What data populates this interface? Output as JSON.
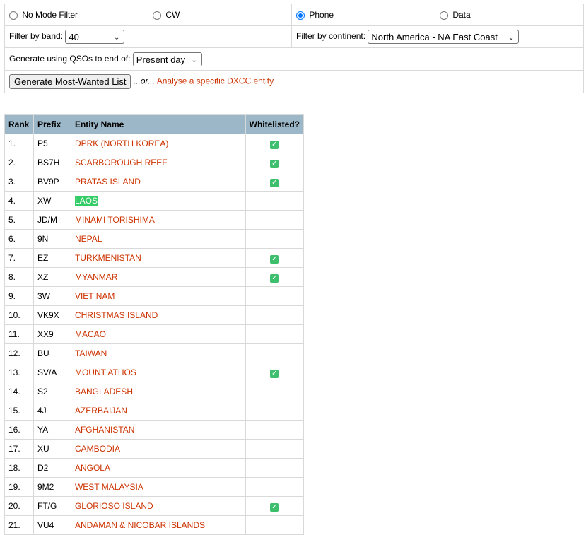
{
  "mode_filter": {
    "options": [
      {
        "label": "No Mode Filter",
        "checked": false
      },
      {
        "label": "CW",
        "checked": false
      },
      {
        "label": "Phone",
        "checked": true
      },
      {
        "label": "Data",
        "checked": false
      }
    ]
  },
  "band_filter": {
    "label": "Filter by band:",
    "value": "40"
  },
  "continent_filter": {
    "label": "Filter by continent:",
    "value": "North America - NA East Coast"
  },
  "qso_filter": {
    "label": "Generate using QSOs to end of:",
    "value": "Present day"
  },
  "generate": {
    "button_label": "Generate Most-Wanted List",
    "or_text": "...or...",
    "analyse_link": "Analyse a specific DXCC entity"
  },
  "table": {
    "headers": [
      "Rank",
      "Prefix",
      "Entity Name",
      "Whitelisted?"
    ],
    "rows": [
      {
        "rank": "1.",
        "prefix": "P5",
        "entity": "DPRK (NORTH KOREA)",
        "whitelisted": true
      },
      {
        "rank": "2.",
        "prefix": "BS7H",
        "entity": "SCARBOROUGH REEF",
        "whitelisted": true
      },
      {
        "rank": "3.",
        "prefix": "BV9P",
        "entity": "PRATAS ISLAND",
        "whitelisted": true
      },
      {
        "rank": "4.",
        "prefix": "XW",
        "entity": "LAOS",
        "whitelisted": false,
        "highlight": true
      },
      {
        "rank": "5.",
        "prefix": "JD/M",
        "entity": "MINAMI TORISHIMA",
        "whitelisted": false
      },
      {
        "rank": "6.",
        "prefix": "9N",
        "entity": "NEPAL",
        "whitelisted": false
      },
      {
        "rank": "7.",
        "prefix": "EZ",
        "entity": "TURKMENISTAN",
        "whitelisted": true
      },
      {
        "rank": "8.",
        "prefix": "XZ",
        "entity": "MYANMAR",
        "whitelisted": true
      },
      {
        "rank": "9.",
        "prefix": "3W",
        "entity": "VIET NAM",
        "whitelisted": false
      },
      {
        "rank": "10.",
        "prefix": "VK9X",
        "entity": "CHRISTMAS ISLAND",
        "whitelisted": false
      },
      {
        "rank": "11.",
        "prefix": "XX9",
        "entity": "MACAO",
        "whitelisted": false
      },
      {
        "rank": "12.",
        "prefix": "BU",
        "entity": "TAIWAN",
        "whitelisted": false
      },
      {
        "rank": "13.",
        "prefix": "SV/A",
        "entity": "MOUNT ATHOS",
        "whitelisted": true
      },
      {
        "rank": "14.",
        "prefix": "S2",
        "entity": "BANGLADESH",
        "whitelisted": false
      },
      {
        "rank": "15.",
        "prefix": "4J",
        "entity": "AZERBAIJAN",
        "whitelisted": false
      },
      {
        "rank": "16.",
        "prefix": "YA",
        "entity": "AFGHANISTAN",
        "whitelisted": false
      },
      {
        "rank": "17.",
        "prefix": "XU",
        "entity": "CAMBODIA",
        "whitelisted": false
      },
      {
        "rank": "18.",
        "prefix": "D2",
        "entity": "ANGOLA",
        "whitelisted": false
      },
      {
        "rank": "19.",
        "prefix": "9M2",
        "entity": "WEST MALAYSIA",
        "whitelisted": false
      },
      {
        "rank": "20.",
        "prefix": "FT/G",
        "entity": "GLORIOSO ISLAND",
        "whitelisted": true
      },
      {
        "rank": "21.",
        "prefix": "VU4",
        "entity": "ANDAMAN & NICOBAR ISLANDS",
        "whitelisted": false
      }
    ]
  },
  "colors": {
    "link": "#cc3300",
    "header_bg": "#9bb7c8",
    "check_green": "#3dbf6e",
    "highlight_green": "#33cc66"
  },
  "icons": {
    "whitelisted": "checkbox-checked-icon",
    "dropdown": "chevron-down-icon"
  }
}
